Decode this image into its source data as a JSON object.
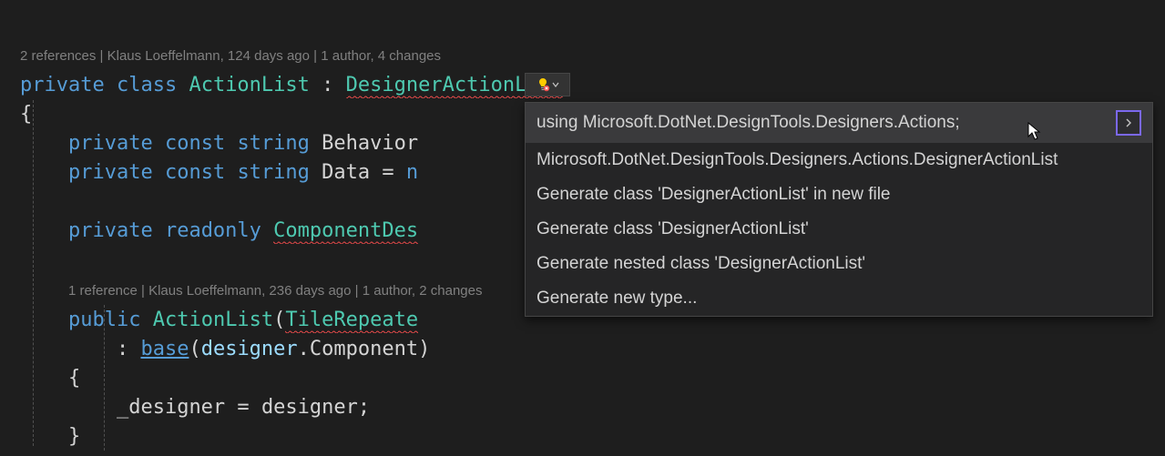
{
  "codelens": {
    "class": "2 references | Klaus Loeffelmann, 124 days ago | 1 author, 4 changes",
    "ctor": "1 reference | Klaus Loeffelmann, 236 days ago | 1 author, 2 changes"
  },
  "code": {
    "kw_private": "private",
    "kw_class": "class",
    "cls_ActionList": "ActionList",
    "colon": " : ",
    "cls_DesignerActionList": "DesignerActionList",
    "brace_open": "{",
    "kw_const": "const",
    "kw_string": "string",
    "fld_Behavior": "Behavior",
    "fld_Data": "Data",
    "eq": " = ",
    "n_frag": "n",
    "kw_readonly": "readonly",
    "cls_ComponentDes": "ComponentDes",
    "kw_public": "public",
    "paren_open": "(",
    "cls_TileRepeater": "TileRepeate",
    "colon2": ": ",
    "kw_base": "base",
    "param_designer": "designer",
    "dot": ".",
    "prop_Component": "Component",
    "paren_close": ")",
    "fld__designer": "_designer",
    "local_designer": "designer",
    "semi": ";",
    "brace_close": "}"
  },
  "popup": {
    "items": [
      "using Microsoft.DotNet.DesignTools.Designers.Actions;",
      "Microsoft.DotNet.DesignTools.Designers.Actions.DesignerActionList",
      "Generate class 'DesignerActionList' in new file",
      "Generate class 'DesignerActionList'",
      "Generate nested class 'DesignerActionList'",
      "Generate new type..."
    ]
  }
}
